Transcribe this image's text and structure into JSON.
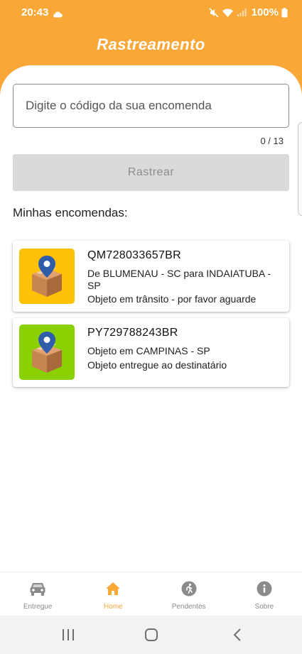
{
  "status": {
    "time": "20:43",
    "battery": "100%"
  },
  "header": {
    "title": "Rastreamento"
  },
  "search": {
    "placeholder": "Digite o código da sua encomenda",
    "value": "",
    "counter": "0 / 13"
  },
  "track_button": {
    "label": "Rastrear"
  },
  "section": {
    "title": "Minhas encomendas:"
  },
  "packages": [
    {
      "code": "QM728033657BR",
      "line1": "De BLUMENAU - SC para INDAIATUBA - SP",
      "line2": "Objeto em trânsito - por favor aguarde",
      "thumb_color": "#FFC107",
      "icon": "box-location-icon"
    },
    {
      "code": "PY729788243BR",
      "line1": "Objeto em  CAMPINAS - SP",
      "line2": "Objeto entregue ao destinatário",
      "thumb_color": "#8BD000",
      "icon": "box-location-icon"
    }
  ],
  "nav": {
    "items": [
      {
        "label": "Entregue",
        "icon": "car-icon",
        "active": false
      },
      {
        "label": "Home",
        "icon": "home-icon",
        "active": true
      },
      {
        "label": "Pendentes",
        "icon": "walking-icon",
        "active": false
      },
      {
        "label": "Sobre",
        "icon": "info-icon",
        "active": false
      }
    ]
  },
  "colors": {
    "accent": "#F9A837",
    "inactive_nav": "#8b8b8b",
    "button_disabled": "#dadada"
  }
}
